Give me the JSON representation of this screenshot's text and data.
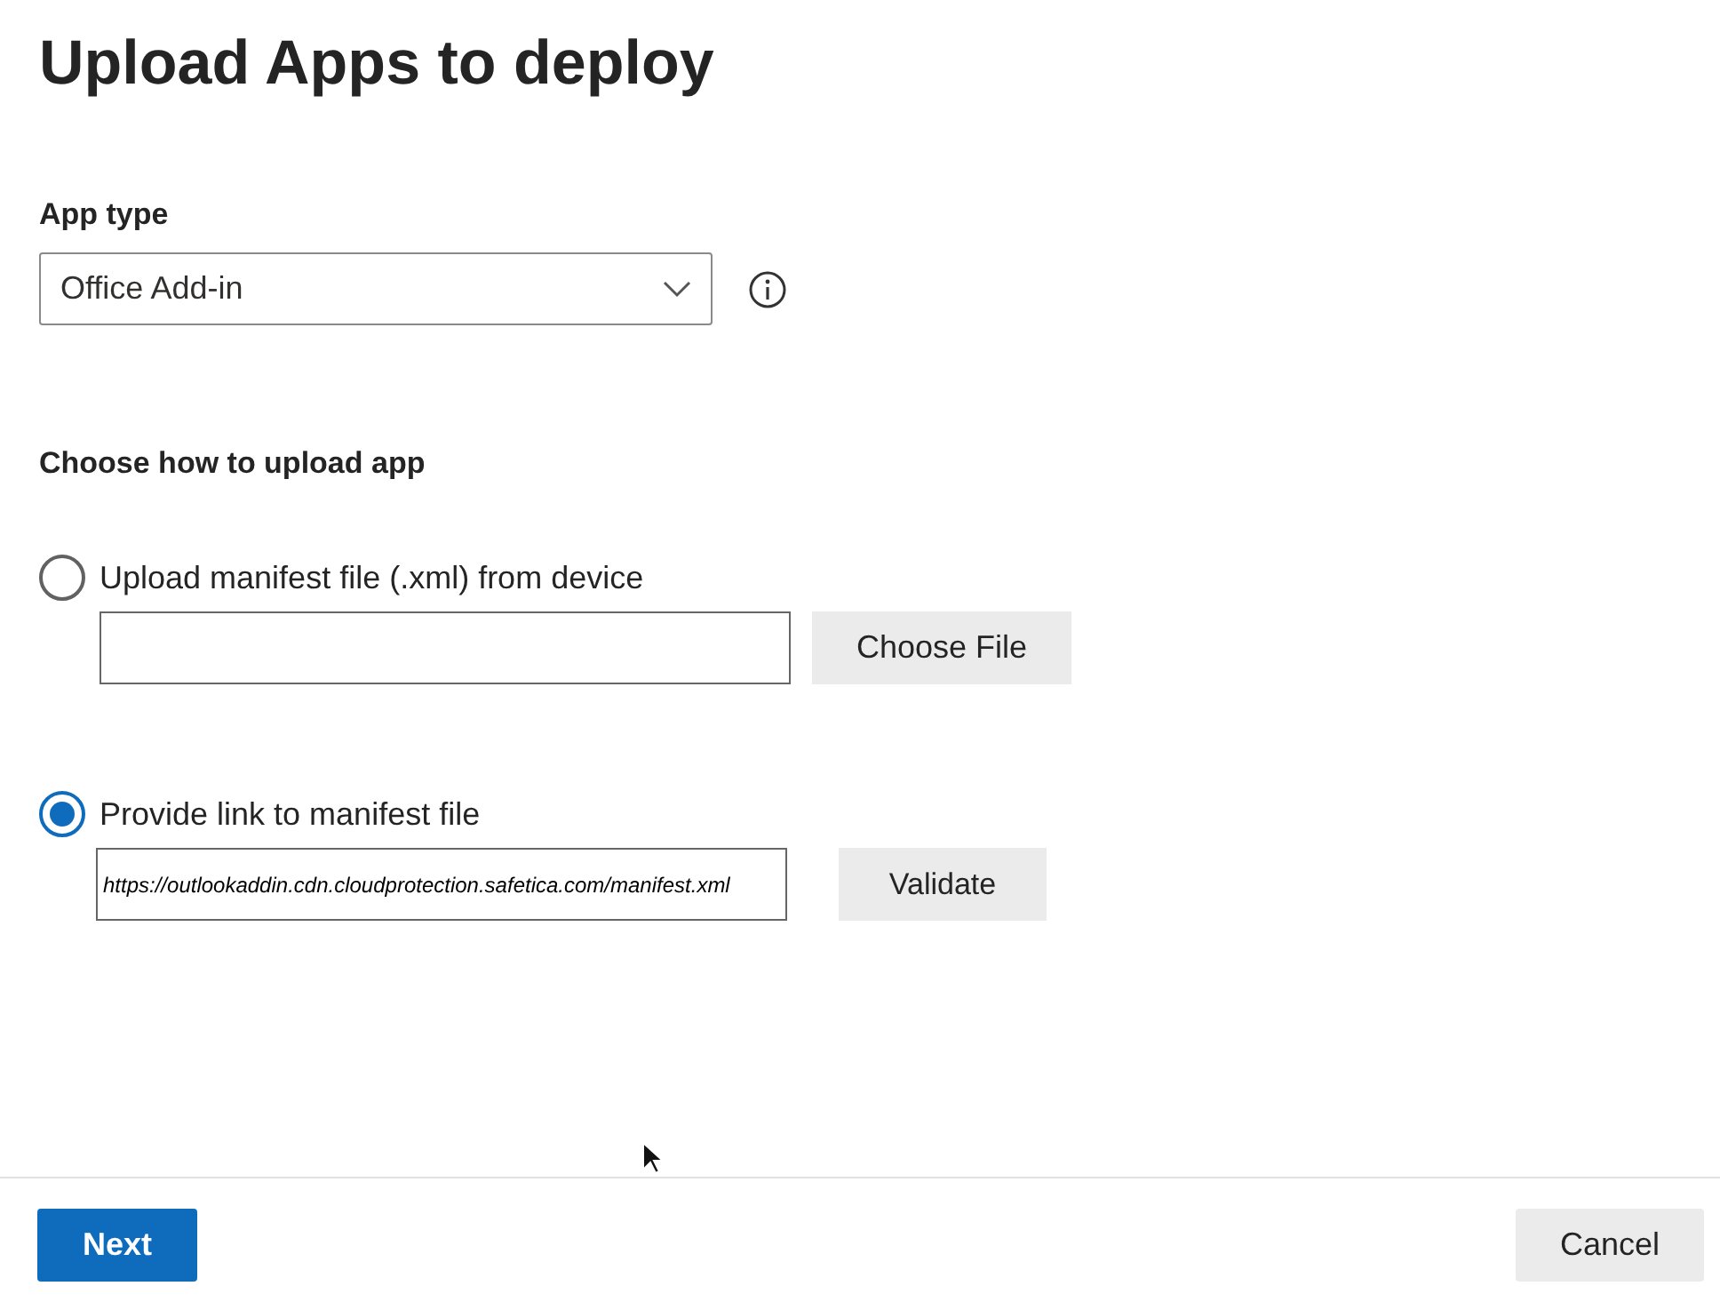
{
  "title": "Upload Apps to deploy",
  "app_type": {
    "label": "App type",
    "value": "Office Add-in"
  },
  "upload_section": {
    "heading": "Choose how to upload app",
    "options": [
      {
        "kind": "file",
        "label": "Upload manifest file (.xml) from device",
        "selected": false,
        "button": "Choose File"
      },
      {
        "kind": "link",
        "label": "Provide link to manifest file",
        "selected": true,
        "value": "https://outlookaddin.cdn.cloudprotection.safetica.com/manifest.xml",
        "button": "Validate"
      }
    ]
  },
  "footer": {
    "primary": "Next",
    "secondary": "Cancel"
  }
}
